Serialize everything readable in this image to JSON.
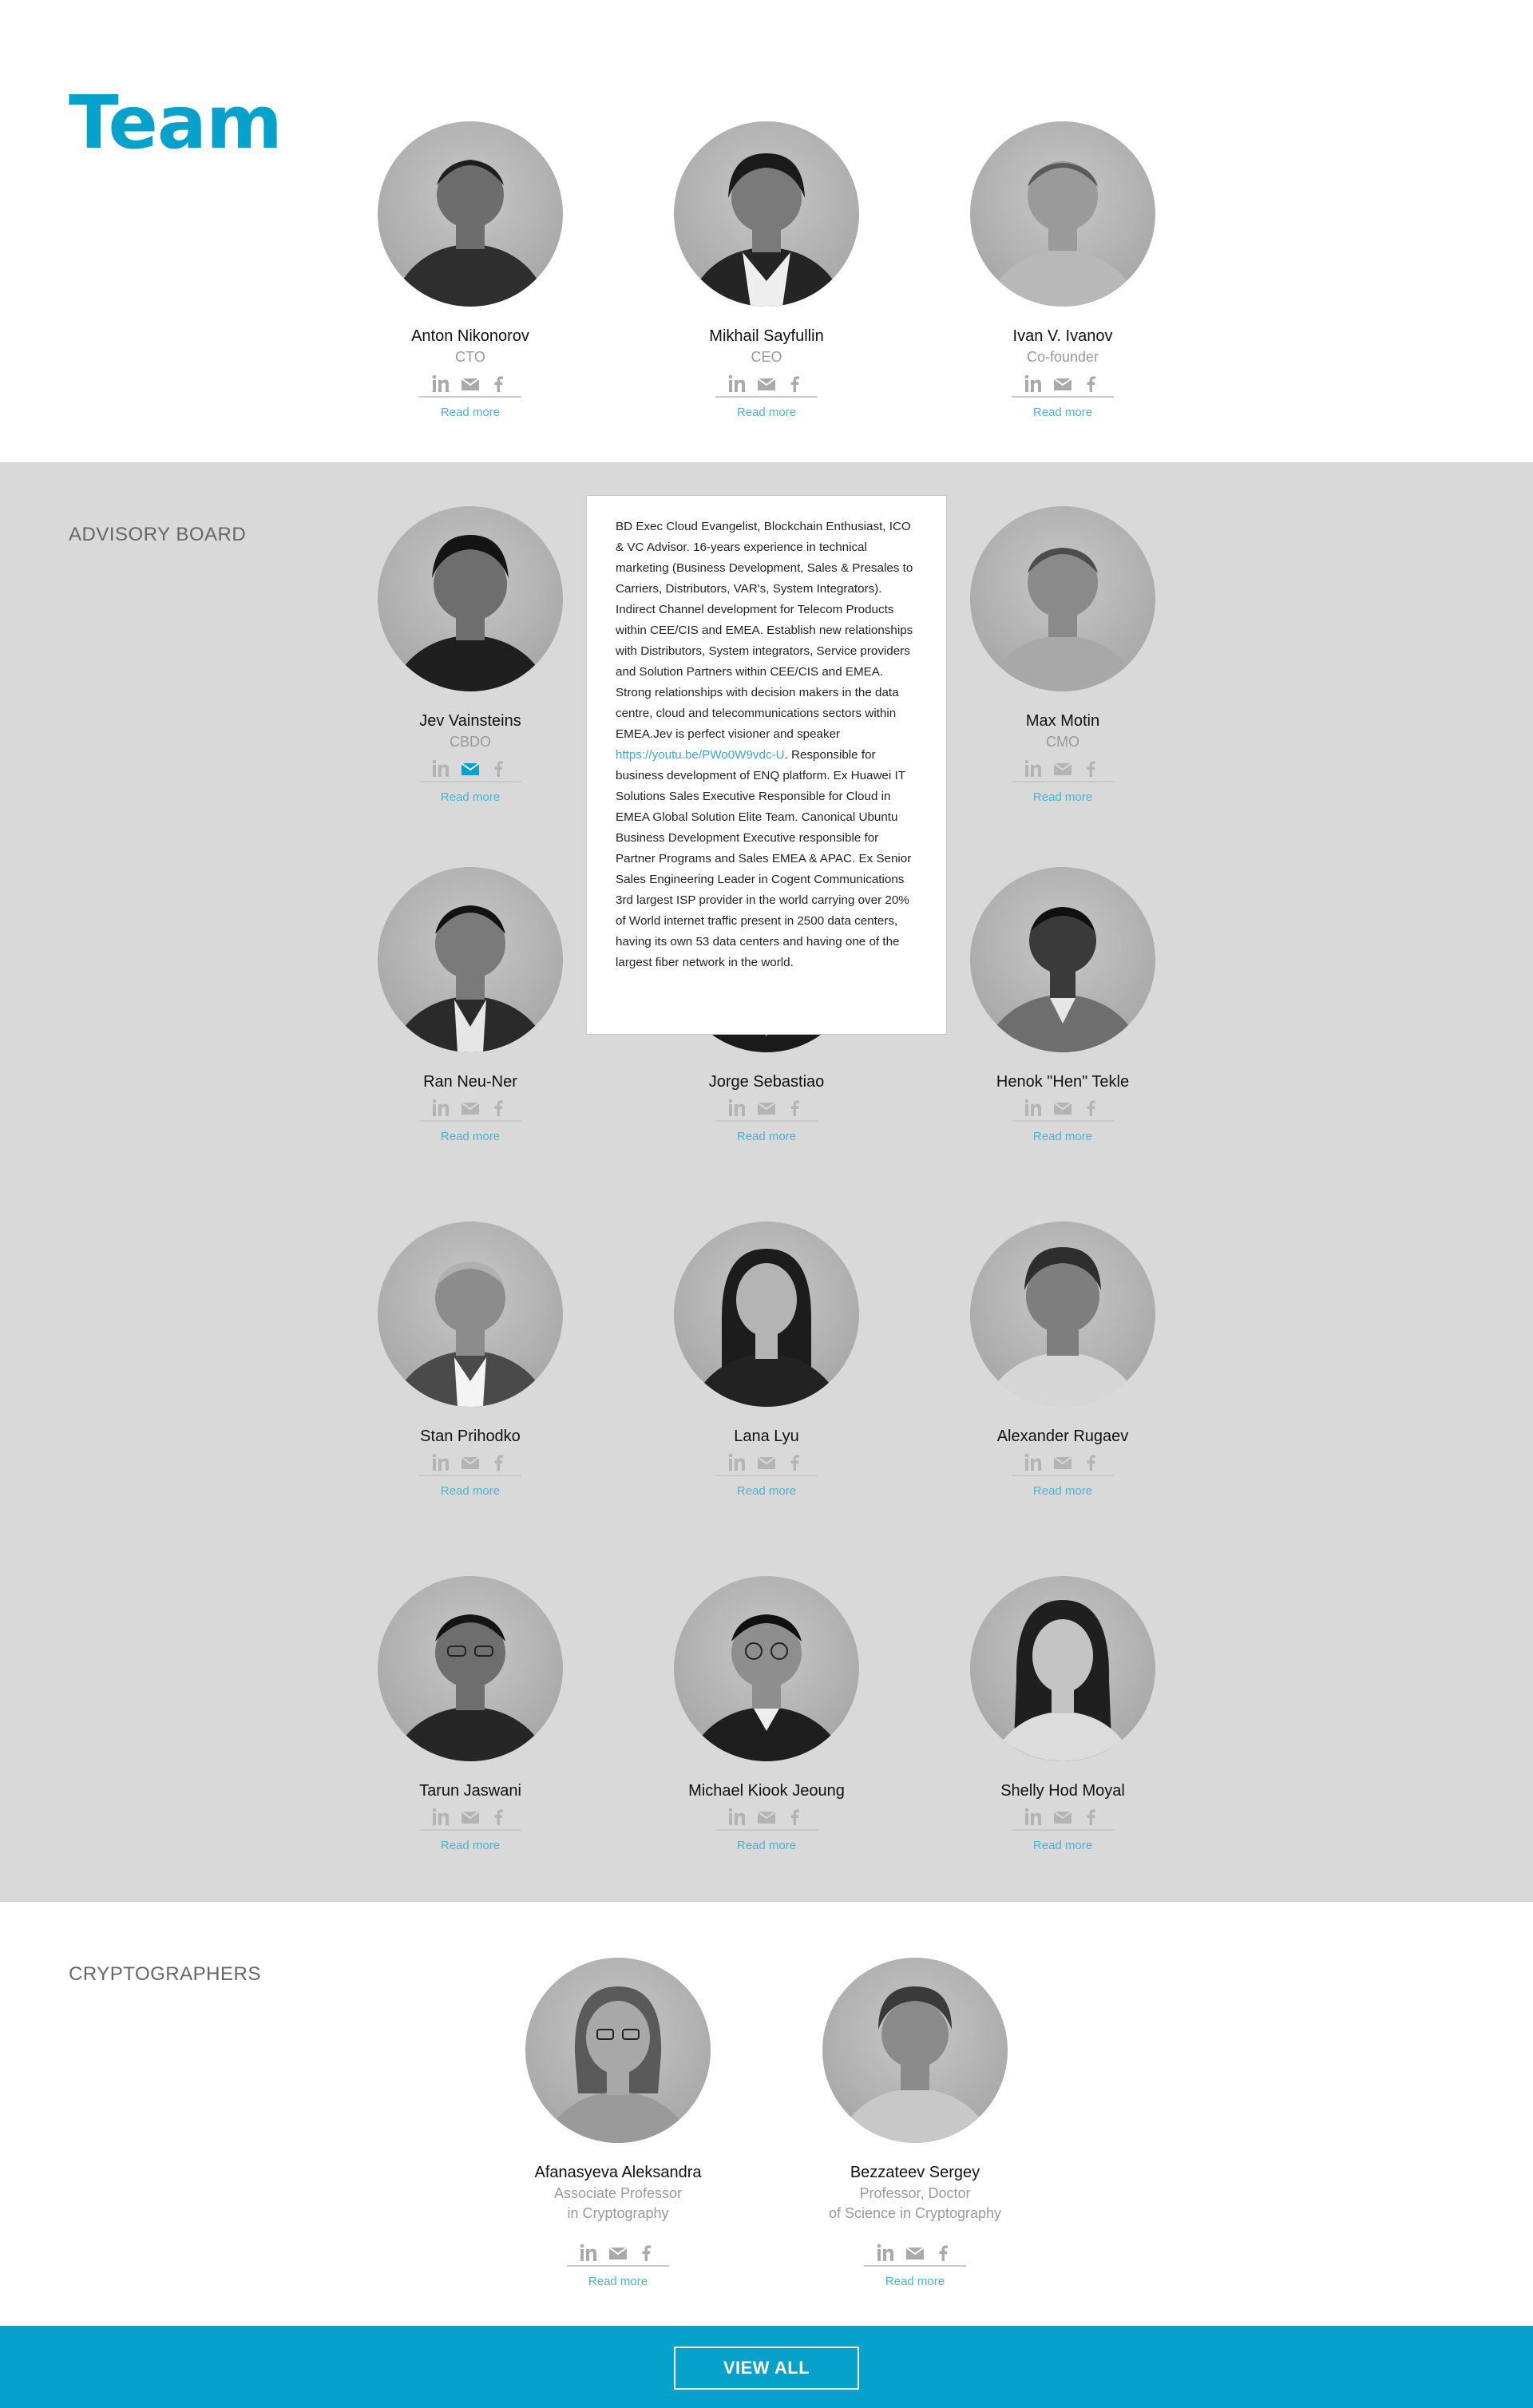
{
  "page_title": "Team",
  "colors": {
    "accent": "#06a2cb",
    "link": "#4ab3d3",
    "muted": "#999999",
    "board_bg": "#d9d9d9"
  },
  "team": [
    {
      "name": "Anton Nikonorov",
      "role": "CTO",
      "read_more": "Read more"
    },
    {
      "name": "Mikhail Sayfullin",
      "role": "CEO",
      "read_more": "Read more"
    },
    {
      "name": "Ivan V. Ivanov",
      "role": "Co-founder",
      "read_more": "Read more"
    }
  ],
  "advisory": {
    "label": "ADVISORY BOARD",
    "members": [
      {
        "name": "Jev Vainsteins",
        "role": "CBDO",
        "read_more": "Read more"
      },
      {
        "name": "Max Motin",
        "role": "CMO",
        "read_more": "Read more"
      },
      {
        "name": "Ran Neu-Ner",
        "role": "",
        "read_more": "Read more"
      },
      {
        "name": "Jorge Sebastiao",
        "role": "",
        "read_more": "Read more"
      },
      {
        "name": "Henok \"Hen\" Tekle",
        "role": "",
        "read_more": "Read more"
      },
      {
        "name": "Stan Prihodko",
        "role": "",
        "read_more": "Read more"
      },
      {
        "name": "Lana Lyu",
        "role": "",
        "read_more": "Read more"
      },
      {
        "name": "Alexander Rugaev",
        "role": "",
        "read_more": "Read more"
      },
      {
        "name": "Tarun Jaswani",
        "role": "",
        "read_more": "Read more"
      },
      {
        "name": "Michael Kiook Jeoung",
        "role": "",
        "read_more": "Read more"
      },
      {
        "name": "Shelly Hod Moyal",
        "role": "",
        "read_more": "Read more"
      }
    ]
  },
  "popup": {
    "text_before": "BD Exec Cloud Evangelist, Blockchain Enthusiast, ICO & VC Advisor. 16-years experience in technical marketing (Business Development, Sales & Presales to Carriers, Distributors, VAR's, System Integrators). Indirect Channel development for Telecom Products within CEE/CIS and EMEA. Establish new relationships with Distributors, System integrators, Service providers and Solution Partners within CEE/CIS and EMEA. Strong relationships with decision makers in the data centre, cloud and telecommunications sectors within EMEA.Jev is perfect visioner and speaker ",
    "link": "https://youtu.be/PWo0W9vdc-U",
    "text_after": ". Responsible for business development of ENQ platform. Ex Huawei IT Solutions Sales Executive Responsible for Cloud in EMEA Global Solution Elite Team. Canonical Ubuntu Business Development Executive responsible for Partner Programs and Sales EMEA & APAC. Ex Senior Sales Engineering Leader in Cogent Communications 3rd largest ISP provider in the world carrying over 20% of World internet traffic present in 2500 data centers, having its own 53 data centers and having one of the largest fiber network in the world."
  },
  "cryptographers": {
    "label": "CRYPTOGRAPHERS",
    "members": [
      {
        "name": "Afanasyeva Aleksandra",
        "role_line1": "Associate Professor",
        "role_line2": "in Cryptography",
        "read_more": "Read more"
      },
      {
        "name": "Bezzateev Sergey",
        "role_line1": "Professor, Doctor",
        "role_line2": "of Science in Cryptography",
        "read_more": "Read more"
      }
    ]
  },
  "footer": {
    "button": "VIEW ALL"
  },
  "icons": [
    "linkedin-icon",
    "mail-icon",
    "facebook-icon"
  ]
}
